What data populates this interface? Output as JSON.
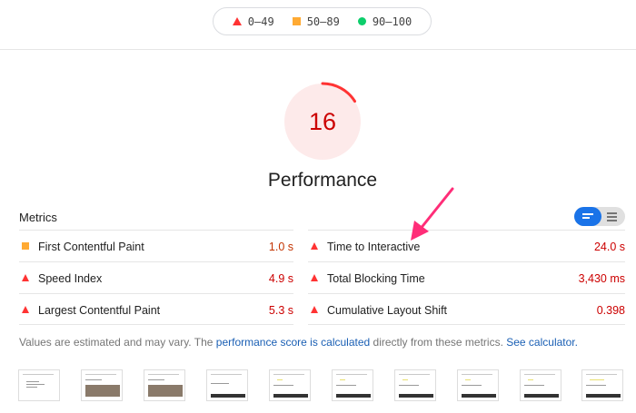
{
  "legend": {
    "fail": "0–49",
    "average": "50–89",
    "pass": "90–100"
  },
  "gauge": {
    "score": "16",
    "score_fraction": 0.16,
    "title": "Performance",
    "color": "#ff3333"
  },
  "metrics": {
    "header": "Metrics",
    "left": [
      {
        "rating": "average",
        "icon": "orange-square-icon",
        "label": "First Contentful Paint",
        "value": "1.0 s"
      },
      {
        "rating": "fail",
        "icon": "red-triangle-icon",
        "label": "Speed Index",
        "value": "4.9 s"
      },
      {
        "rating": "fail",
        "icon": "red-triangle-icon",
        "label": "Largest Contentful Paint",
        "value": "5.3 s"
      }
    ],
    "right": [
      {
        "rating": "fail",
        "icon": "red-triangle-icon",
        "label": "Time to Interactive",
        "value": "24.0 s"
      },
      {
        "rating": "fail",
        "icon": "red-triangle-icon",
        "label": "Total Blocking Time",
        "value": "3,430 ms"
      },
      {
        "rating": "fail",
        "icon": "red-triangle-icon",
        "label": "Cumulative Layout Shift",
        "value": "0.398"
      }
    ]
  },
  "note": {
    "prefix": "Values are estimated and may vary. The ",
    "link1": "performance score is calculated",
    "middle": " directly from these metrics. ",
    "link2": "See calculator."
  },
  "colors": {
    "fail": "#ff3333",
    "average": "#ffaa33",
    "pass": "#0cce6b",
    "accent": "#1a73e8",
    "annotation_arrow": "#ff2d78"
  }
}
